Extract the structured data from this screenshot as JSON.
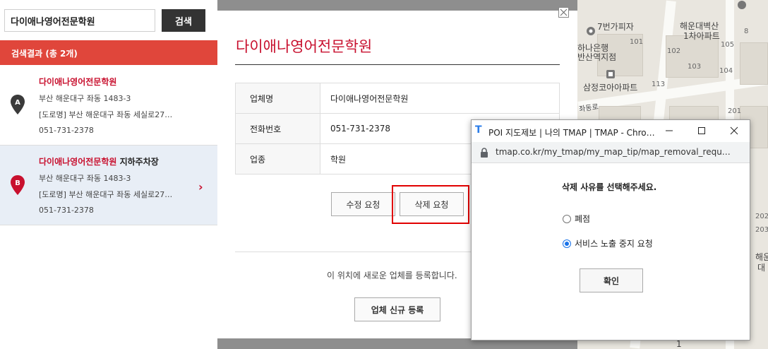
{
  "search": {
    "value": "다이애나영어전문학원",
    "button_label": "검색"
  },
  "results_header": "검색결과 (총 2개)",
  "results": [
    {
      "marker": "A",
      "name": "다이애나영어전문학원",
      "sub_name": "",
      "address": "부산 해운대구 좌동 1483-3",
      "road_address": "[도로명] 부산 해운대구 좌동 세실로27…",
      "phone": "051-731-2378",
      "marker_color": "#3a3a3a"
    },
    {
      "marker": "B",
      "name": "다이애나영어전문학원",
      "sub_name": " 지하주차장",
      "address": "부산 해운대구 좌동 1483-3",
      "road_address": "[도로명] 부산 해운대구 좌동 세실로27…",
      "phone": "051-731-2378",
      "marker_color": "#c8102e"
    }
  ],
  "detail": {
    "title": "다이애나영어전문학원",
    "rows": [
      {
        "key": "업체명",
        "value": "다이애나영어전문학원"
      },
      {
        "key": "전화번호",
        "value": "051-731-2378"
      },
      {
        "key": "업종",
        "value": "학원"
      }
    ],
    "edit_button": "수정 요청",
    "delete_button": "삭제 요청",
    "register_text": "이 위치에 새로운 업체를 등록합니다.",
    "register_button": "업체 신규 등록"
  },
  "popup": {
    "title": "POI 지도제보 | 나의 TMAP | TMAP - Chro…",
    "logo": "T",
    "url": "tmap.co.kr/my_tmap/my_map_tip/map_removal_requ…",
    "prompt": "삭제 사유를 선택해주세요.",
    "options": [
      {
        "label": "폐점",
        "selected": false
      },
      {
        "label": "서비스 노출 중지 요청",
        "selected": true
      }
    ],
    "confirm_button": "확인"
  },
  "map": {
    "labels": [
      "7번가피자",
      "해운대벽산",
      "1차아파트",
      "하나은행",
      "반산역지점",
      "삼정코아아파트",
      "좌동로",
      "해운",
      "대",
      "1"
    ],
    "numbers": [
      "101",
      "102",
      "103",
      "104",
      "105",
      "113",
      "201",
      "202",
      "203",
      "8"
    ]
  },
  "colors": {
    "accent": "#c8102e",
    "result_bar": "#e0463b",
    "highlight": "#e10000",
    "selected_row": "#e8eef6"
  }
}
